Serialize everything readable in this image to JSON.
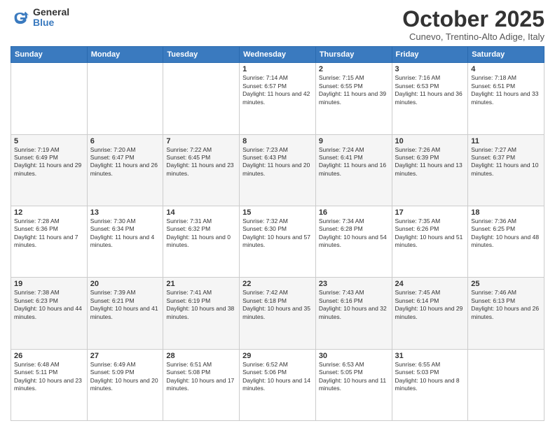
{
  "header": {
    "logo_general": "General",
    "logo_blue": "Blue",
    "month_title": "October 2025",
    "subtitle": "Cunevo, Trentino-Alto Adige, Italy"
  },
  "days_of_week": [
    "Sunday",
    "Monday",
    "Tuesday",
    "Wednesday",
    "Thursday",
    "Friday",
    "Saturday"
  ],
  "weeks": [
    [
      {
        "day": "",
        "info": ""
      },
      {
        "day": "",
        "info": ""
      },
      {
        "day": "",
        "info": ""
      },
      {
        "day": "1",
        "info": "Sunrise: 7:14 AM\nSunset: 6:57 PM\nDaylight: 11 hours and 42 minutes."
      },
      {
        "day": "2",
        "info": "Sunrise: 7:15 AM\nSunset: 6:55 PM\nDaylight: 11 hours and 39 minutes."
      },
      {
        "day": "3",
        "info": "Sunrise: 7:16 AM\nSunset: 6:53 PM\nDaylight: 11 hours and 36 minutes."
      },
      {
        "day": "4",
        "info": "Sunrise: 7:18 AM\nSunset: 6:51 PM\nDaylight: 11 hours and 33 minutes."
      }
    ],
    [
      {
        "day": "5",
        "info": "Sunrise: 7:19 AM\nSunset: 6:49 PM\nDaylight: 11 hours and 29 minutes."
      },
      {
        "day": "6",
        "info": "Sunrise: 7:20 AM\nSunset: 6:47 PM\nDaylight: 11 hours and 26 minutes."
      },
      {
        "day": "7",
        "info": "Sunrise: 7:22 AM\nSunset: 6:45 PM\nDaylight: 11 hours and 23 minutes."
      },
      {
        "day": "8",
        "info": "Sunrise: 7:23 AM\nSunset: 6:43 PM\nDaylight: 11 hours and 20 minutes."
      },
      {
        "day": "9",
        "info": "Sunrise: 7:24 AM\nSunset: 6:41 PM\nDaylight: 11 hours and 16 minutes."
      },
      {
        "day": "10",
        "info": "Sunrise: 7:26 AM\nSunset: 6:39 PM\nDaylight: 11 hours and 13 minutes."
      },
      {
        "day": "11",
        "info": "Sunrise: 7:27 AM\nSunset: 6:37 PM\nDaylight: 11 hours and 10 minutes."
      }
    ],
    [
      {
        "day": "12",
        "info": "Sunrise: 7:28 AM\nSunset: 6:36 PM\nDaylight: 11 hours and 7 minutes."
      },
      {
        "day": "13",
        "info": "Sunrise: 7:30 AM\nSunset: 6:34 PM\nDaylight: 11 hours and 4 minutes."
      },
      {
        "day": "14",
        "info": "Sunrise: 7:31 AM\nSunset: 6:32 PM\nDaylight: 11 hours and 0 minutes."
      },
      {
        "day": "15",
        "info": "Sunrise: 7:32 AM\nSunset: 6:30 PM\nDaylight: 10 hours and 57 minutes."
      },
      {
        "day": "16",
        "info": "Sunrise: 7:34 AM\nSunset: 6:28 PM\nDaylight: 10 hours and 54 minutes."
      },
      {
        "day": "17",
        "info": "Sunrise: 7:35 AM\nSunset: 6:26 PM\nDaylight: 10 hours and 51 minutes."
      },
      {
        "day": "18",
        "info": "Sunrise: 7:36 AM\nSunset: 6:25 PM\nDaylight: 10 hours and 48 minutes."
      }
    ],
    [
      {
        "day": "19",
        "info": "Sunrise: 7:38 AM\nSunset: 6:23 PM\nDaylight: 10 hours and 44 minutes."
      },
      {
        "day": "20",
        "info": "Sunrise: 7:39 AM\nSunset: 6:21 PM\nDaylight: 10 hours and 41 minutes."
      },
      {
        "day": "21",
        "info": "Sunrise: 7:41 AM\nSunset: 6:19 PM\nDaylight: 10 hours and 38 minutes."
      },
      {
        "day": "22",
        "info": "Sunrise: 7:42 AM\nSunset: 6:18 PM\nDaylight: 10 hours and 35 minutes."
      },
      {
        "day": "23",
        "info": "Sunrise: 7:43 AM\nSunset: 6:16 PM\nDaylight: 10 hours and 32 minutes."
      },
      {
        "day": "24",
        "info": "Sunrise: 7:45 AM\nSunset: 6:14 PM\nDaylight: 10 hours and 29 minutes."
      },
      {
        "day": "25",
        "info": "Sunrise: 7:46 AM\nSunset: 6:13 PM\nDaylight: 10 hours and 26 minutes."
      }
    ],
    [
      {
        "day": "26",
        "info": "Sunrise: 6:48 AM\nSunset: 5:11 PM\nDaylight: 10 hours and 23 minutes."
      },
      {
        "day": "27",
        "info": "Sunrise: 6:49 AM\nSunset: 5:09 PM\nDaylight: 10 hours and 20 minutes."
      },
      {
        "day": "28",
        "info": "Sunrise: 6:51 AM\nSunset: 5:08 PM\nDaylight: 10 hours and 17 minutes."
      },
      {
        "day": "29",
        "info": "Sunrise: 6:52 AM\nSunset: 5:06 PM\nDaylight: 10 hours and 14 minutes."
      },
      {
        "day": "30",
        "info": "Sunrise: 6:53 AM\nSunset: 5:05 PM\nDaylight: 10 hours and 11 minutes."
      },
      {
        "day": "31",
        "info": "Sunrise: 6:55 AM\nSunset: 5:03 PM\nDaylight: 10 hours and 8 minutes."
      },
      {
        "day": "",
        "info": ""
      }
    ]
  ]
}
